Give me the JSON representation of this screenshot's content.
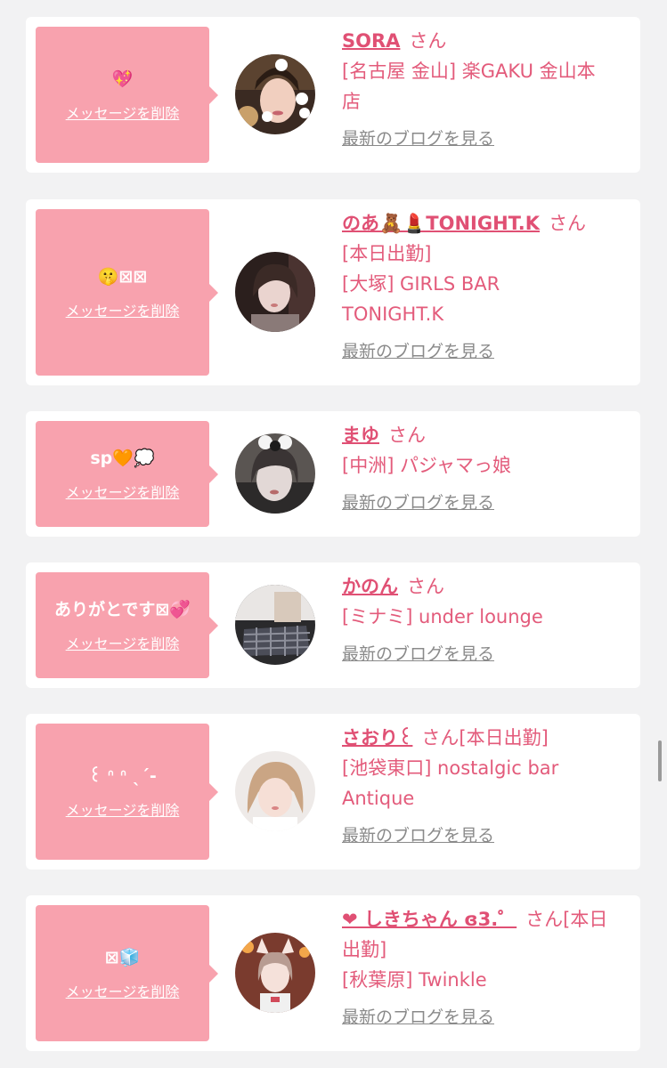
{
  "common": {
    "delete_label": "メッセージを削除",
    "blog_label": "最新のブログを見る"
  },
  "cards": [
    {
      "message": "💖",
      "name": "SORA",
      "suffix": "さん",
      "lines": [
        "[名古屋 金山] 楽GAKU 金山本",
        "店"
      ]
    },
    {
      "message": "🤫⊠⊠",
      "name": "のあ🧸💄TONIGHT.K",
      "suffix": "さん",
      "lines": [
        "[本日出勤]",
        "[大塚] GIRLS BAR",
        "TONIGHT.K"
      ]
    },
    {
      "message": "sp🧡💭",
      "name": "まゆ",
      "suffix": "さん",
      "lines": [
        "[中洲] パジャマっ娘"
      ]
    },
    {
      "message": "ありがとです⊠💞",
      "name": "かのん",
      "suffix": "さん",
      "lines": [
        "[ミナミ] under lounge"
      ]
    },
    {
      "message": "꒰ ᐢ ᐢ ˎˊ-",
      "name": "さおり꒰",
      "suffix": "さん[本日出勤]",
      "lines": [
        "[池袋東口] nostalgic bar",
        "Antique"
      ]
    },
    {
      "message": "⊠🧊",
      "name": "❤︎ しきちゃん ɞ3.゜",
      "suffix": "さん[本日",
      "lines": [
        "出勤]",
        "[秋葉原] Twinkle"
      ]
    }
  ],
  "colors": {
    "bubble": "#f8a2ae",
    "accent": "#e35b7b",
    "background": "#f2f2f3"
  }
}
